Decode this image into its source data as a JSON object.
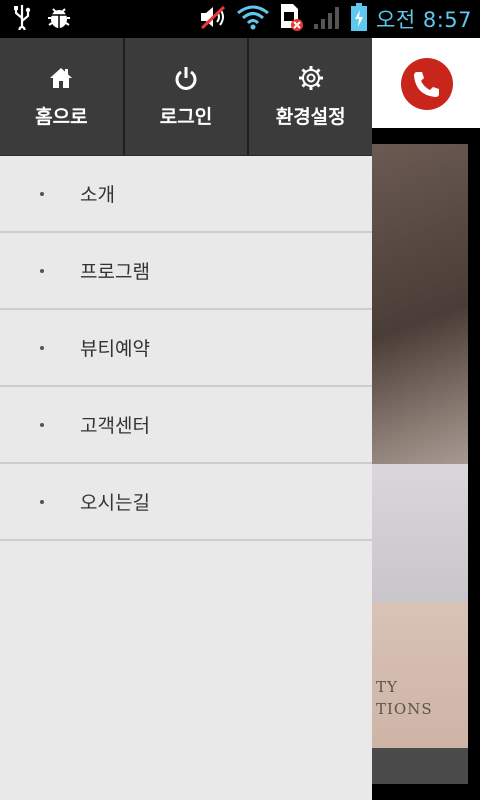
{
  "statusbar": {
    "time": "오전 8:57",
    "icons": [
      "usb-icon",
      "debug-bug-icon",
      "volume-muted-icon",
      "wifi-icon",
      "sim-error-icon",
      "signal-icon",
      "battery-charging-icon"
    ],
    "time_color": "#5ec8ef"
  },
  "drawer": {
    "top_buttons": [
      {
        "label": "홈으로",
        "icon": "home-icon"
      },
      {
        "label": "로그인",
        "icon": "power-icon"
      },
      {
        "label": "환경설정",
        "icon": "gear-icon"
      }
    ],
    "menu": [
      {
        "label": "소개"
      },
      {
        "label": "프로그램"
      },
      {
        "label": "뷰티예약"
      },
      {
        "label": "고객센터"
      },
      {
        "label": "오시는길"
      }
    ]
  },
  "background_page": {
    "call_icon": "phone-call-icon",
    "call_color": "#c8261b",
    "text_lines": [
      "TY",
      "TIONS"
    ]
  }
}
